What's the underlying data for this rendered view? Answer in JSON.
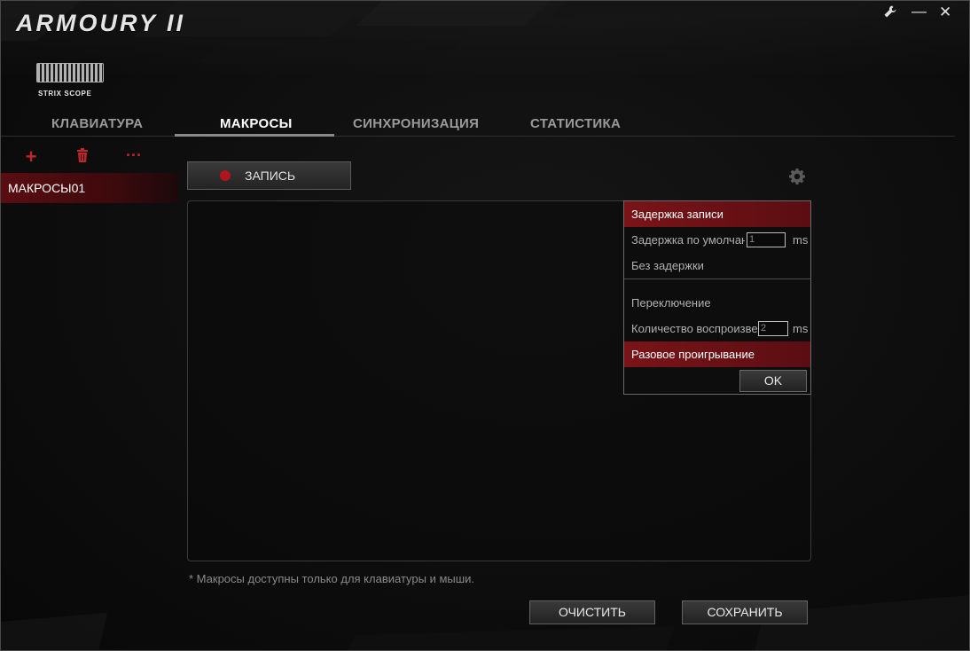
{
  "app": {
    "title": "ARMOURY II"
  },
  "window": {
    "settings_icon": "wrench-icon",
    "minimize_label": "—",
    "close_label": "✕"
  },
  "device": {
    "name": "STRIX SCOPE"
  },
  "tabs": [
    {
      "label": "КЛАВИАТУРА"
    },
    {
      "label": "МАКРОСЫ"
    },
    {
      "label": "СИНХРОНИЗАЦИЯ"
    },
    {
      "label": "СТАТИСТИКА"
    }
  ],
  "left_panel": {
    "add_label": "+",
    "more_label": "···",
    "macros": [
      {
        "label": "МАКРОСЫ01"
      }
    ]
  },
  "record": {
    "label": "ЗАПИСЬ"
  },
  "popup": {
    "record_delay": "Задержка записи",
    "default_delay": "Задержка по умолчан",
    "default_delay_value": "1",
    "default_delay_unit": "ms",
    "no_delay": "Без задержки",
    "toggle": "Переключение",
    "play_count": "Количество воспроизве",
    "play_count_value": "2",
    "play_count_unit": "ms",
    "single_play": "Разовое проигрывание",
    "ok_label": "OK"
  },
  "note": "* Макросы доступны только для клавиатуры и мыши.",
  "buttons": {
    "clear_label": "ОЧИСТИТЬ",
    "save_label": "СОХРАНИТЬ"
  },
  "colors": {
    "accent": "#b0141c",
    "background": "#0b0b0b"
  }
}
